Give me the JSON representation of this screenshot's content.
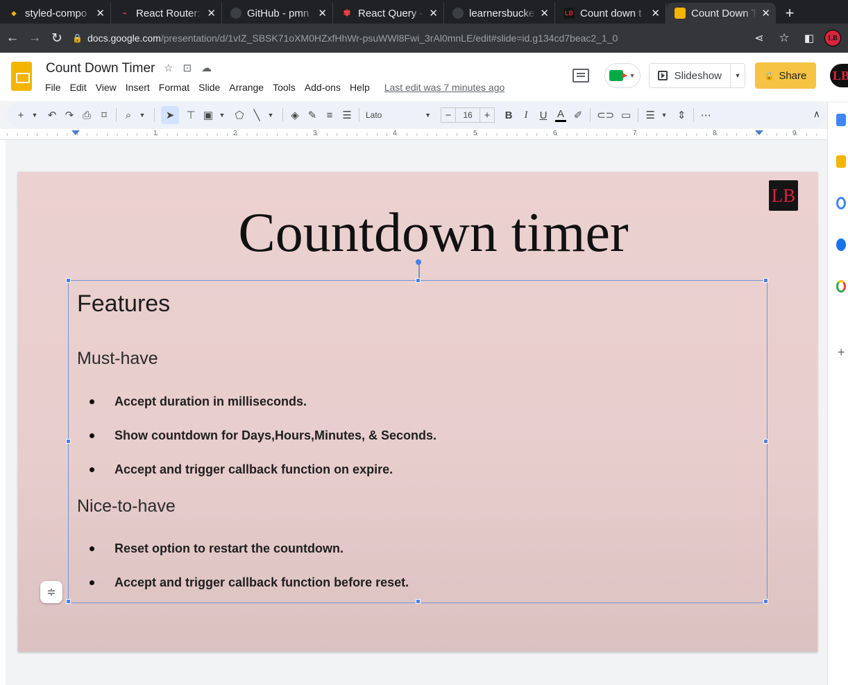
{
  "browser": {
    "tabs": [
      {
        "label": "styled-compo",
        "favicon_color": "#f4b400",
        "active": false
      },
      {
        "label": "React Router:",
        "favicon_color": "#ca4245",
        "active": false
      },
      {
        "label": "GitHub - pmn",
        "favicon_color": "#5f6368",
        "active": false
      },
      {
        "label": "React Query -",
        "favicon_color": "#ef4444",
        "active": false
      },
      {
        "label": "learnersbucke",
        "favicon_color": "#5f6368",
        "active": false
      },
      {
        "label": "Count down t",
        "favicon_color": "#d7263d",
        "active": false
      },
      {
        "label": "Count Down T",
        "favicon_color": "#f4b400",
        "active": true
      }
    ],
    "tab_close_glyph": "✕",
    "new_tab_glyph": "+",
    "url_host": "docs.google.com",
    "url_path": "/presentation/d/1vIZ_SBSK71oXM0HZxfHhWr-psuWWl8Fwi_3rAl0mnLE/edit#slide=id.g134cd7beac2_1_0",
    "profile_initials": "LB"
  },
  "doc": {
    "title": "Count Down Timer",
    "menu": [
      "File",
      "Edit",
      "View",
      "Insert",
      "Format",
      "Slide",
      "Arrange",
      "Tools",
      "Add-ons",
      "Help"
    ],
    "last_edit": "Last edit was 7 minutes ago",
    "slideshow_label": "Slideshow",
    "share_label": "Share",
    "account_initials": "LB"
  },
  "toolbar": {
    "font": "Lato",
    "font_size": "16"
  },
  "ruler": {
    "numbers": [
      "1",
      "2",
      "3",
      "4",
      "5",
      "6",
      "7",
      "8",
      "9"
    ]
  },
  "slide": {
    "logo_text": "LB",
    "title": "Countdown timer",
    "heading": "Features",
    "must_have_label": "Must-have",
    "must_have": [
      "Accept duration in milliseconds.",
      "Show countdown for Days,Hours,Minutes, & Seconds.",
      "Accept and trigger callback function on expire."
    ],
    "nice_to_have_label": "Nice-to-have",
    "nice_to_have": [
      "Reset option to restart the countdown.",
      "Accept and trigger callback function before reset."
    ]
  },
  "colors": {
    "slide_background": "#ecd1d1",
    "selection_blue": "#4a80e8",
    "share_yellow": "#f6c343",
    "brand_red": "#d7263d"
  }
}
